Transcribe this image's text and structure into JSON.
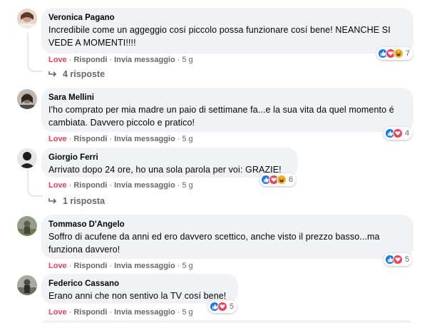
{
  "comments": [
    {
      "author": "Veronica Pagano",
      "text": "Incredibile come un aggeggio cosí piccolo possa funzionare cosí bene! NEANCHE SI VEDE A MOMENTI!!!!",
      "love": "Love",
      "reply": "Rispondi",
      "message": "Invia messaggio",
      "time": "5 g",
      "reaction_count": "7",
      "replies": "4 risposte"
    },
    {
      "author": "Sara Mellini",
      "text": "I'ho comprato per mia madre un paio di settimane fa...e la sua vita da quel momento é cambiata. Davvero piccolo e pratico!",
      "love": "Love",
      "reply": "Rispondi",
      "message": "Invia messaggio",
      "time": "5 g",
      "reaction_count": "4"
    },
    {
      "author": "Giorgio Ferri",
      "text": "Arrivato dopo 24 ore, ho una sola parola per voi: GRAZIE!",
      "love": "Love",
      "reply": "Rispondi",
      "message": "Invia messaggio",
      "time": "5 g",
      "reaction_count": "6",
      "replies": "1 risposta"
    },
    {
      "author": "Tommaso D'Angelo",
      "text": "Soffro di acufene da anni ed ero davvero scettico, anche visto il prezzo basso...ma funziona davvero!",
      "love": "Love",
      "reply": "Rispondi",
      "message": "Invia messaggio",
      "time": "5 g",
      "reaction_count": "5"
    },
    {
      "author": "Federico Cassano",
      "text": "Erano anni che non sentivo la TV cosí bene!",
      "love": "Love",
      "reply": "Rispondi",
      "message": "Invia messaggio",
      "time": "5 g",
      "reaction_count": "5"
    }
  ],
  "colors": {
    "love": "#f33e58",
    "like": "#1877f2",
    "haha": "#f7b125",
    "bubble": "#f0f2f5",
    "secondary_text": "#65676b"
  },
  "icons": {
    "like": "thumbs-up-icon",
    "love": "heart-icon",
    "haha": "laugh-icon",
    "reply_arrow": "reply-arrow-icon"
  }
}
